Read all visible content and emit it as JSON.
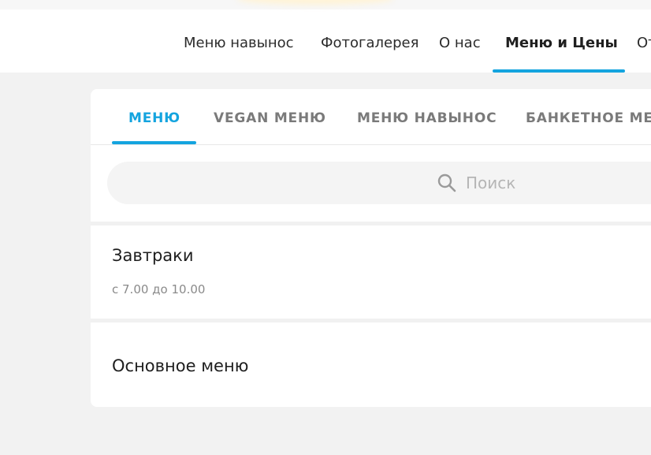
{
  "nav": {
    "items": [
      {
        "label": "Меню навынос"
      },
      {
        "label": "Фотогалерея"
      },
      {
        "label": "О нас"
      },
      {
        "label": "Меню и Цены"
      },
      {
        "label": "От"
      }
    ],
    "active_index": 3
  },
  "tabs": {
    "items": [
      {
        "label": "МЕНЮ"
      },
      {
        "label": "VEGAN МЕНЮ"
      },
      {
        "label": "МЕНЮ НАВЫНОС"
      },
      {
        "label": "БАНКЕТНОЕ МЕНЮ"
      }
    ],
    "active_index": 0
  },
  "search": {
    "placeholder": "Поиск",
    "value": "",
    "icon": "search-icon"
  },
  "sections": [
    {
      "title": "Завтраки",
      "subtitle": "с 7.00 до 10.00"
    },
    {
      "title": "Основное меню"
    }
  ],
  "colors": {
    "accent": "#14a4df",
    "page_background": "#f2f2f2",
    "card_background": "#ffffff"
  }
}
